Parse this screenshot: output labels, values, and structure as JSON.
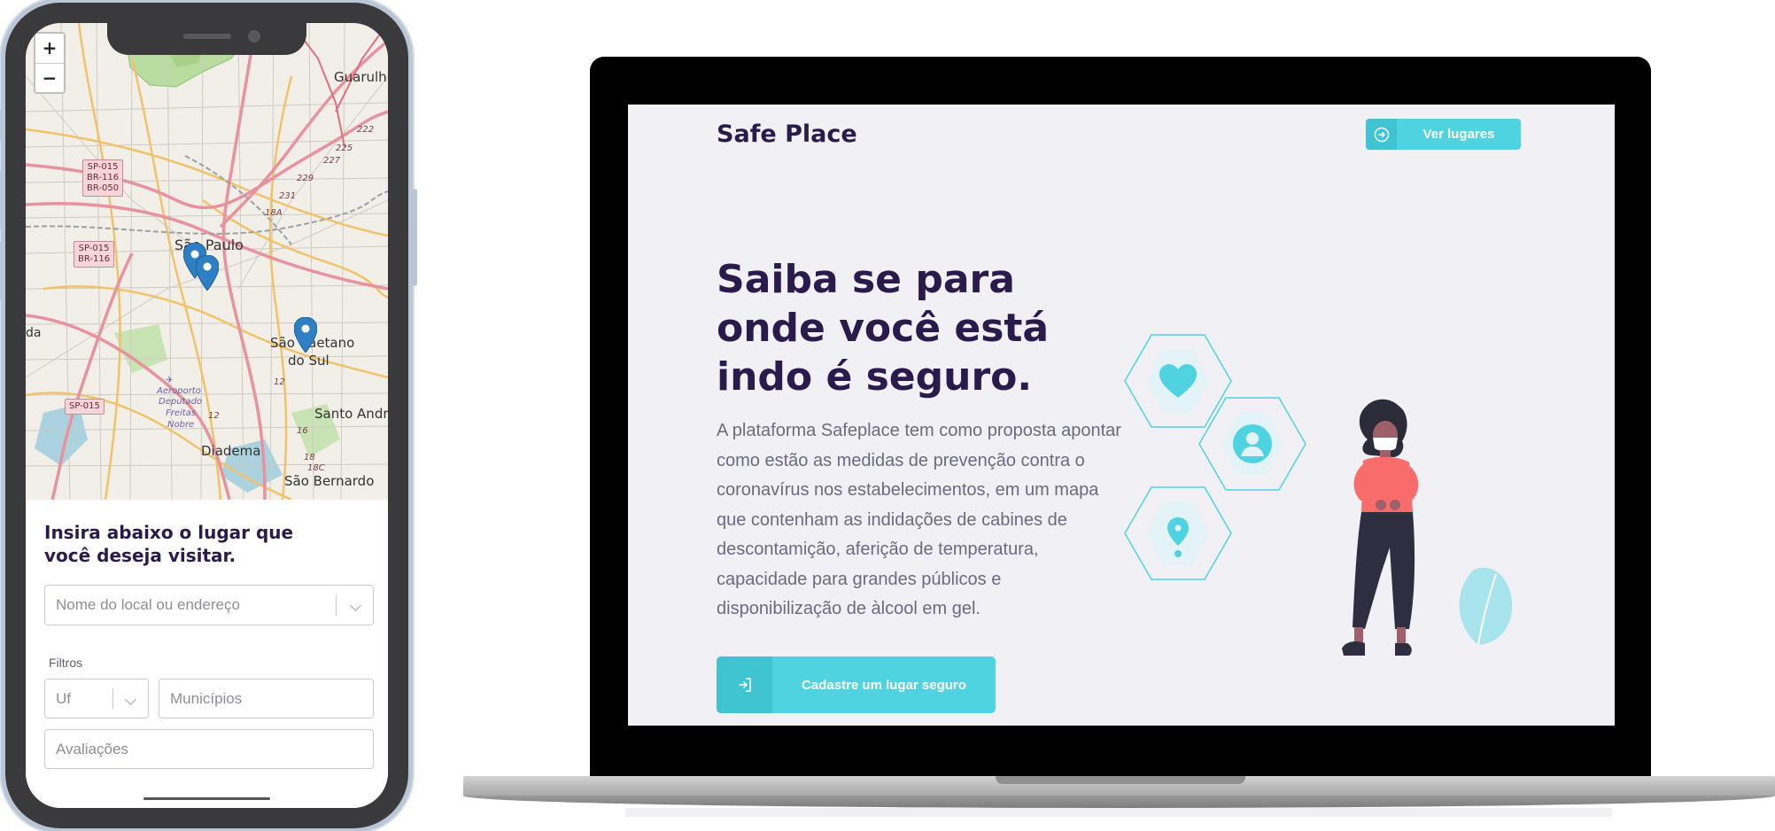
{
  "phone": {
    "map": {
      "zoom_in": "+",
      "zoom_out": "−",
      "labels": {
        "sao_paulo": "São Paulo",
        "guarulhos": "Guarulh",
        "sao_caetano_1": "São Caetano",
        "sao_caetano_2": "do Sul",
        "santo_andre": "Santo Andr",
        "diadema": "Diadema",
        "sao_bernardo": "São Bernardo",
        "airport_1": "Aeroporto",
        "airport_2": "Deputado",
        "airport_3": "Freitas",
        "airport_4": "Nobre",
        "edge_left": "da"
      },
      "shields": {
        "s1": "SP-015\nBR-116\nBR-050",
        "s2": "SP-015\nBR-116",
        "s3": "SP-015"
      },
      "road_numbers": [
        "222",
        "225",
        "227",
        "229",
        "231",
        "18A",
        "12",
        "12",
        "16",
        "18",
        "18C"
      ]
    },
    "form": {
      "heading": "Insira abaixo o lugar que você deseja visitar.",
      "search_placeholder": "Nome do local ou endereço",
      "filters_label": "Filtros",
      "uf_placeholder": "Uf",
      "municipios_placeholder": "Municípios",
      "avaliacoes_placeholder": "Avaliações"
    }
  },
  "laptop": {
    "brand": "Safe Place",
    "nav_button": "Ver lugares",
    "hero_title": "Saiba se para onde você está indo é seguro.",
    "hero_text": "A plataforma Safeplace tem como proposta apontar como estão as medidas de prevenção contra o coronavírus nos estabelecimentos, em um mapa que contenham as indidações de cabines de descontamição, aferição de temperatura, capacidade para grandes públicos e disponibilização de àlcool em gel.",
    "cta_button": "Cadastre um lugar seguro",
    "icons": [
      "heart-icon",
      "user-icon",
      "map-pin-icon"
    ]
  },
  "colors": {
    "accent": "#4fd3e0",
    "accent_dark": "#40c4d1",
    "title": "#2b1b4d",
    "text": "#6b6b80",
    "screen_bg": "#f0f0f5",
    "pin": "#2f7fc4"
  }
}
